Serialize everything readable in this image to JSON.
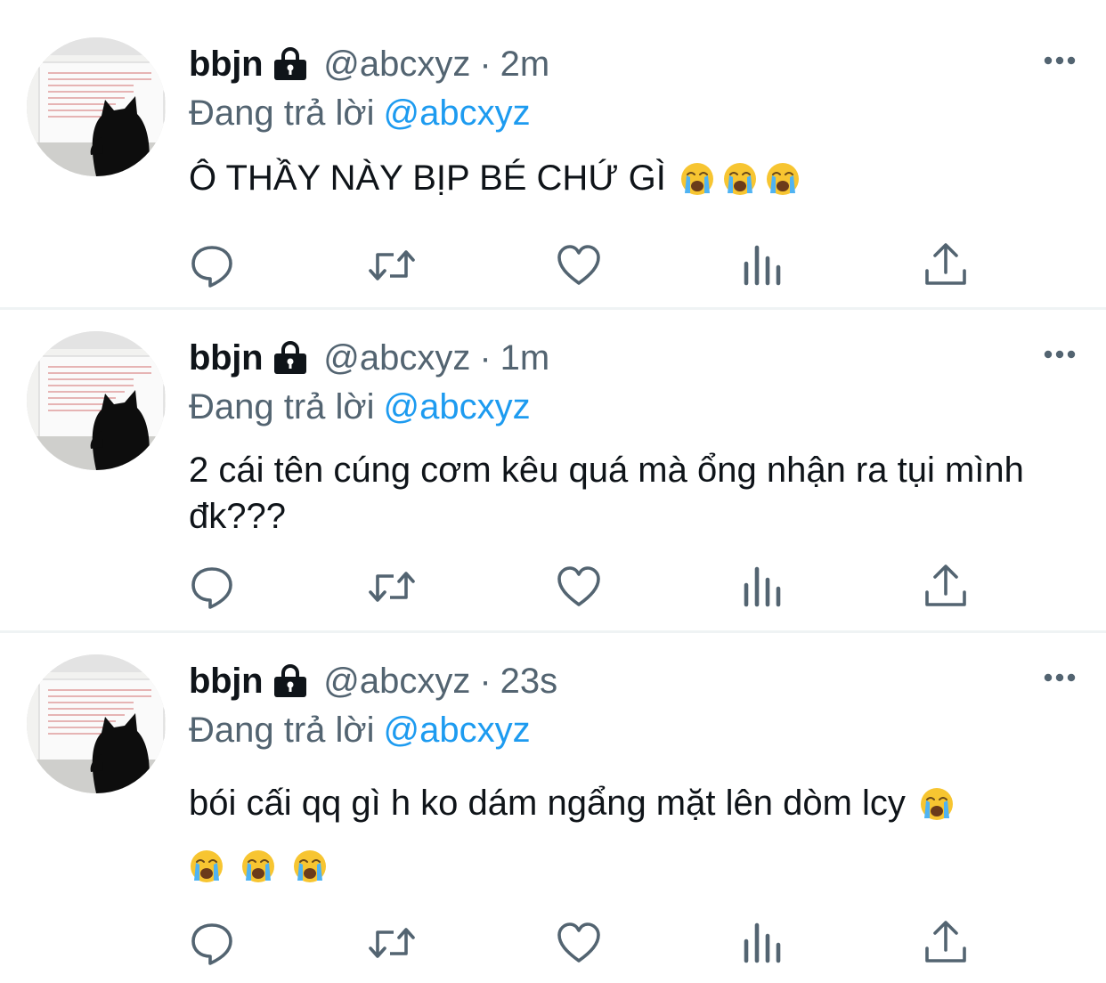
{
  "tweets": [
    {
      "name": "bbjn",
      "handle": "@abcxyz",
      "dot": "·",
      "time": "2m",
      "reply_prefix": "Đang trả lời",
      "reply_mention": "@abcxyz",
      "text": "Ô THẦY NÀY BỊP BÉ CHỨ GÌ",
      "emojis": [
        "loudly-crying-face",
        "loudly-crying-face",
        "loudly-crying-face"
      ]
    },
    {
      "name": "bbjn",
      "handle": "@abcxyz",
      "dot": "·",
      "time": "1m",
      "reply_prefix": "Đang trả lời",
      "reply_mention": "@abcxyz",
      "text": "2 cái tên cúng cơm kêu quá mà ổng nhận ra tụi mình đk???",
      "emojis": []
    },
    {
      "name": "bbjn",
      "handle": "@abcxyz",
      "dot": "·",
      "time": "23s",
      "reply_prefix": "Đang trả lời",
      "reply_mention": "@abcxyz",
      "text": "bói cấi qq gì h ko dám ngẩng mặt lên dòm lcy",
      "emojis": [
        "loudly-crying-face",
        "loudly-crying-face",
        "loudly-crying-face",
        "loudly-crying-face"
      ]
    }
  ],
  "icons": {
    "lock": "lock-icon",
    "more": "more-icon",
    "reply": "reply-icon",
    "retweet": "retweet-icon",
    "like": "heart-icon",
    "stats": "analytics-icon",
    "share": "share-icon"
  },
  "colors": {
    "text": "#0f1419",
    "secondary": "#536471",
    "mention": "#1d9bf0",
    "divider": "#eff3f4",
    "emoji_face": "#f7c531",
    "emoji_tears": "#4fb3f2"
  }
}
